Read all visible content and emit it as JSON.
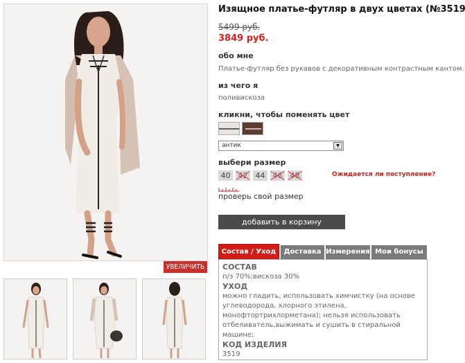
{
  "product": {
    "title": "Изящное платье-футляр в двух цветах (№3519)",
    "old_price": "5499 руб.",
    "new_price": "3849 руб."
  },
  "about": {
    "heading": "обо мне",
    "text": "Платье-футляр без рукавов с декоративным контрастным кантом."
  },
  "material": {
    "heading": "из чего я",
    "text": "поливискоза"
  },
  "color": {
    "heading": "кликни, чтобы поменять цвет",
    "swatches": [
      {
        "name": "антик",
        "color": "#e9e6df"
      },
      {
        "name": "коричневый",
        "color": "#5b3b32"
      }
    ],
    "selected": "антик"
  },
  "size": {
    "heading": "выбери размер",
    "options": [
      {
        "label": "40",
        "available": true
      },
      {
        "label": "42",
        "available": false
      },
      {
        "label": "44",
        "available": true
      },
      {
        "label": "46",
        "available": false
      },
      {
        "label": "48",
        "available": false
      }
    ],
    "waiting_link": "Ожидается ли поступление?",
    "check_link": "проверь свой размер"
  },
  "gallery": {
    "zoom_label": "УВЕЛИЧИТЬ",
    "thumbnails": [
      "thumb-front",
      "thumb-with-jacket-and-bag",
      "thumb-back"
    ]
  },
  "cart": {
    "label": "добавить в корзину"
  },
  "tabs": [
    {
      "label": "Состав / Уход",
      "active": true
    },
    {
      "label": "Доставка",
      "active": false
    },
    {
      "label": "Измерения",
      "active": false
    },
    {
      "label": "Мои бонусы",
      "active": false
    }
  ],
  "details": {
    "composition_heading": "СОСТАВ",
    "composition": "п/э 70%;вискоза 30%",
    "care_heading": "УХОД",
    "care_lines": [
      "можно гладить, использовать химчистку (на основе",
      "углеводорода, хлорного этилена,",
      "монофтортрихлорметана); нельзя использовать",
      "отбеливатель,выжимать и сушить в стиральной",
      "машине;"
    ],
    "code_heading": "КОД ИЗДЕЛИЯ",
    "code": "3519"
  },
  "colors": {
    "accent": "#d01b17",
    "button": "#4a4a4a",
    "tab": "#7a7a7a"
  }
}
